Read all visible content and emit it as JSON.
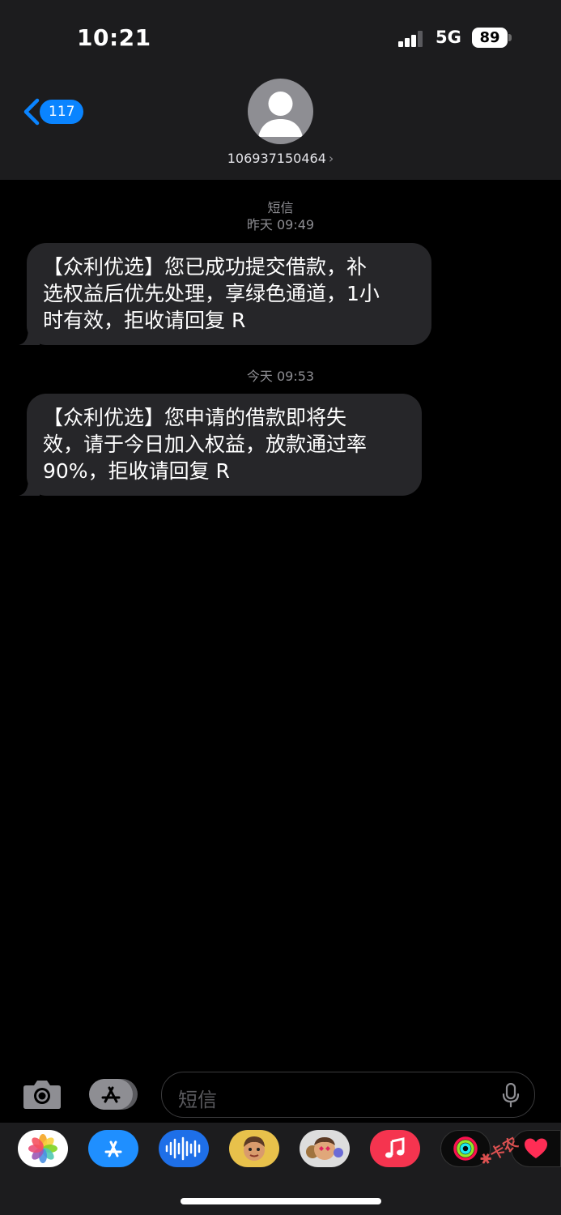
{
  "status": {
    "time": "10:21",
    "network": "5G",
    "battery": "89"
  },
  "nav": {
    "unread_count": "117",
    "sender": "106937150464"
  },
  "conversation": {
    "service": "短信",
    "messages": [
      {
        "timestamp": "昨天 09:49",
        "lines": [
          "【众利优选】您已成功提交借款，补",
          "选权益后优先处理，享绿色通道，1小",
          "时有效，拒收请回复 R"
        ]
      },
      {
        "timestamp": "今天 09:53",
        "lines": [
          "【众利优选】您申请的借款即将失",
          "效，请于今日加入权益，放款通过率",
          "90%，拒收请回复 R"
        ]
      }
    ]
  },
  "composer": {
    "placeholder": "短信"
  },
  "app_strip": [
    "photos-app",
    "app-store-app",
    "audio-app",
    "memoji-app",
    "memoji-stickers-app",
    "music-app",
    "fitness-app",
    "digital-touch-app"
  ],
  "watermark": "卡农社区",
  "colors": {
    "accent": "#0a84ff",
    "bubble": "#262629",
    "header": "#1c1c1e"
  }
}
